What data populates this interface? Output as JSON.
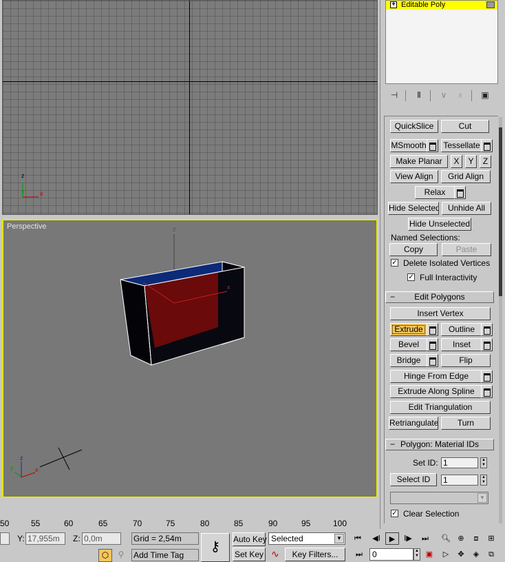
{
  "viewports": {
    "perspective_label": "Perspective"
  },
  "axis_labels": {
    "x": "x",
    "y": "y",
    "z": "z"
  },
  "modifier_stack": {
    "items": [
      {
        "label": "Editable Poly",
        "expander": "+"
      }
    ]
  },
  "stack_toolbar": {
    "icons": [
      "pin-stack-icon",
      "show-end-result-icon",
      "make-unique-icon",
      "remove-modifier-icon",
      "configure-sets-icon"
    ]
  },
  "edit_geometry": {
    "quickslice": "QuickSlice",
    "cut": "Cut",
    "msmooth": "MSmooth",
    "tessellate": "Tessellate",
    "make_planar": "Make Planar",
    "x": "X",
    "y": "Y",
    "z": "Z",
    "view_align": "View Align",
    "grid_align": "Grid Align",
    "relax": "Relax",
    "hide_selected": "Hide Selected",
    "unhide_all": "Unhide All",
    "hide_unselected": "Hide Unselected",
    "named_selections": "Named Selections:",
    "copy": "Copy",
    "paste": "Paste",
    "delete_isolated": "Delete Isolated Vertices",
    "full_interactivity": "Full Interactivity",
    "delete_isolated_checked": true,
    "full_interactivity_checked": true
  },
  "edit_polygons": {
    "sign": "−",
    "title": "Edit Polygons",
    "insert_vertex": "Insert Vertex",
    "extrude": "Extrude",
    "outline": "Outline",
    "bevel": "Bevel",
    "inset": "Inset",
    "bridge": "Bridge",
    "flip": "Flip",
    "hinge_from_edge": "Hinge From Edge",
    "extrude_along_spline": "Extrude Along Spline",
    "edit_triangulation": "Edit Triangulation",
    "retriangulate": "Retriangulate",
    "turn": "Turn",
    "active_tool": "Extrude"
  },
  "material_ids": {
    "sign": "−",
    "title": "Polygon: Material IDs",
    "set_id_label": "Set ID:",
    "set_id_value": "1",
    "select_id_button": "Select ID",
    "select_id_value": "1",
    "clear_selection": "Clear Selection",
    "clear_selection_checked": true
  },
  "timeline": {
    "ticks": [
      "50",
      "55",
      "60",
      "65",
      "70",
      "75",
      "80",
      "85",
      "90",
      "95",
      "100"
    ]
  },
  "status": {
    "y_label": "Y:",
    "y_value": "17,955m",
    "z_label": "Z:",
    "z_value": "0,0m",
    "grid": "Grid = 2,54m",
    "add_time_tag": "Add Time Tag"
  },
  "animation": {
    "auto_key": "Auto Key",
    "set_key": "Set Key",
    "selected": "Selected",
    "key_filters": "Key Filters...",
    "frame": "0"
  },
  "colors": {
    "active_viewport_border": "#e8e800",
    "stack_highlight": "#ffff00",
    "active_button": "#f7c65a",
    "box_top": "#0d2a78",
    "box_face_selected": "#6a0a0a"
  }
}
